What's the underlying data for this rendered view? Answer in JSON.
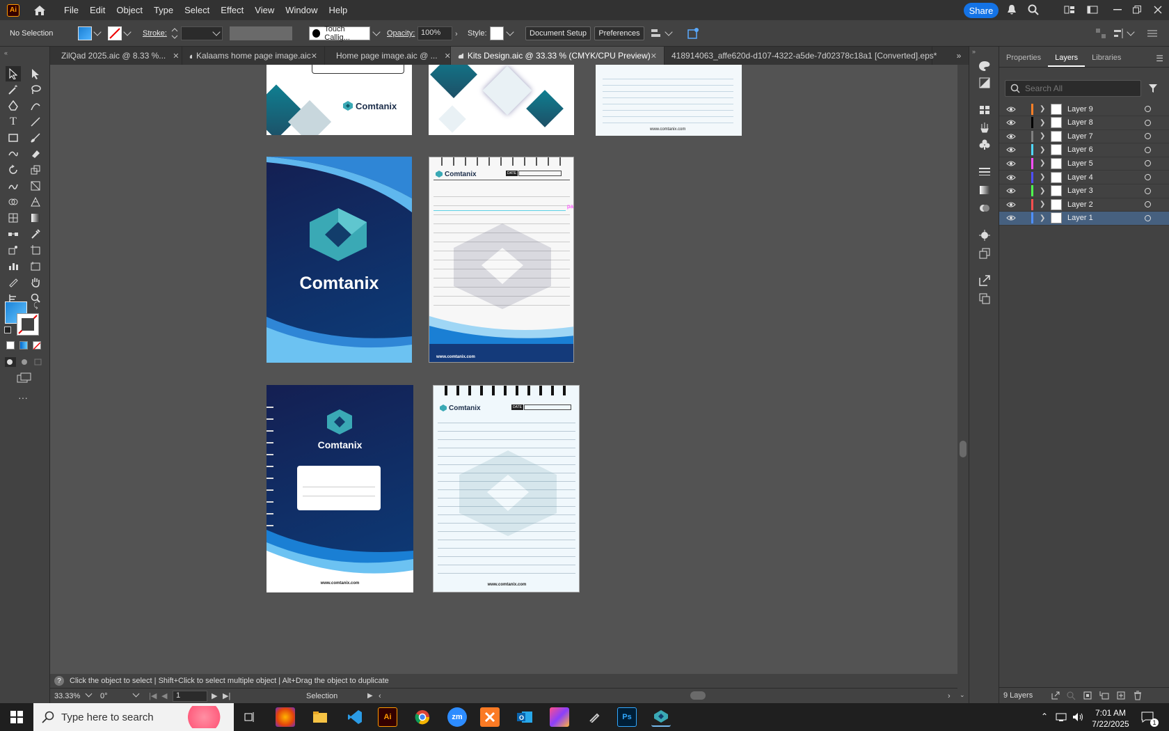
{
  "menubar": {
    "app_logo": "Ai",
    "items": [
      "File",
      "Edit",
      "Object",
      "Type",
      "Select",
      "Effect",
      "View",
      "Window",
      "Help"
    ],
    "share_label": "Share"
  },
  "control_bar": {
    "selection_state": "No Selection",
    "stroke_label": "Stroke:",
    "brush_name": "Touch Callig...",
    "opacity_label": "Opacity:",
    "opacity_value": "100%",
    "style_label": "Style:",
    "document_setup_label": "Document Setup",
    "preferences_label": "Preferences"
  },
  "tabs": [
    {
      "label": "ZilQad 2025.aic @ 8.33 %..."
    },
    {
      "label": "Kalaams home page image.aic"
    },
    {
      "label": "Home page image.aic @ ..."
    },
    {
      "label": "Kits Design.aic @ 33.33 % (CMYK/CPU Preview)"
    },
    {
      "label": "418914063_affe620d-d107-4322-a5de-7d02378c18a1 [Converted].eps*"
    }
  ],
  "canvas": {
    "brand_name": "Comtanix",
    "website": "www.comtanix.com",
    "website_small": "www.comtanix.com",
    "date_label": "DATE",
    "path_hint": "path"
  },
  "status": {
    "hint_text": "Click the object to select  |  Shift+Click to select multiple object  |  Alt+Drag the object to duplicate",
    "zoom": "33.33%",
    "rotation": "0°",
    "artboard": "1",
    "tool_name": "Selection"
  },
  "layers_panel": {
    "tabs": [
      "Properties",
      "Layers",
      "Libraries"
    ],
    "search_placeholder": "Search All",
    "layers": [
      {
        "name": "Layer 9",
        "color": "#ff7f27"
      },
      {
        "name": "Layer 8",
        "color": "#000000"
      },
      {
        "name": "Layer 7",
        "color": "#808080"
      },
      {
        "name": "Layer 6",
        "color": "#4fd8ff"
      },
      {
        "name": "Layer 5",
        "color": "#ff4fff"
      },
      {
        "name": "Layer 4",
        "color": "#4f4fff"
      },
      {
        "name": "Layer 3",
        "color": "#4fff4f"
      },
      {
        "name": "Layer 2",
        "color": "#ff4f4f"
      },
      {
        "name": "Layer 1",
        "color": "#4f8fff"
      }
    ],
    "count_label": "9 Layers"
  },
  "taskbar": {
    "search_placeholder": "Type here to search",
    "time": "7:01 AM",
    "date": "7/22/2025",
    "notification_count": "1"
  }
}
